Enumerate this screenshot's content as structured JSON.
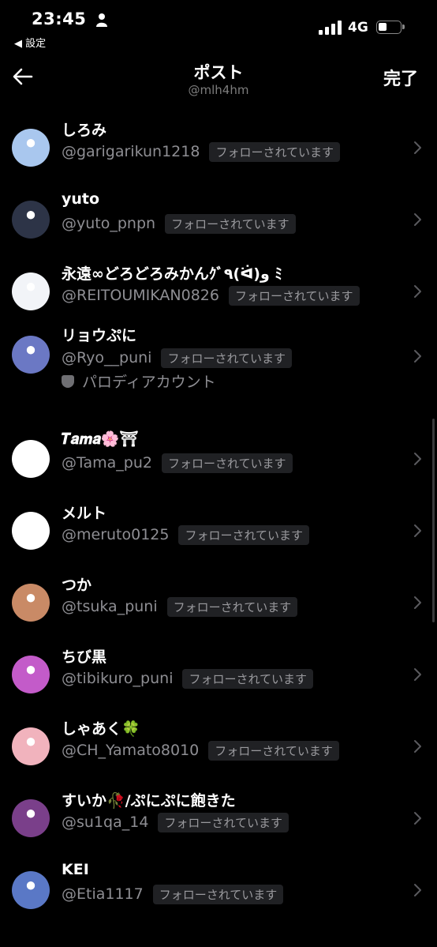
{
  "status_bar": {
    "time": "23:45",
    "back_app": "◀ 設定",
    "network": "4G"
  },
  "header": {
    "title": "ポスト",
    "subtitle": "@mlh4hm",
    "done_label": "完了"
  },
  "users": [
    {
      "name": "しろみ",
      "handle": "@garigarikun1218",
      "badge": "フォローされています",
      "avatar_color": "#a9c7ee"
    },
    {
      "name": "yuto",
      "handle": "@yuto_pnpn",
      "badge": "フォローされています",
      "avatar_color": "#2d3447"
    },
    {
      "name": "永遠∞どろどろみかんｸﾞ٩(ᐛ)و ﾐ",
      "handle": "@REITOUMIKAN0826",
      "badge": "フォローされています",
      "avatar_color": "#f2f4f8"
    },
    {
      "name": "リョウぷに",
      "handle": "@Ryo__puni",
      "badge": "フォローされています",
      "extra": "パロディアカウント",
      "avatar_color": "#6b78c4"
    },
    {
      "name": "𝑻𝒂𝒎𝒂🌸⛩",
      "handle": "@Tama_pu2",
      "badge": "フォローされています",
      "avatar_color": "#ffffff"
    },
    {
      "name": "メルト",
      "handle": "@meruto0125",
      "badge": "フォローされています",
      "avatar_color": "#ffffff"
    },
    {
      "name": "つか",
      "handle": "@tsuka_puni",
      "badge": "フォローされています",
      "avatar_color": "#c98a66"
    },
    {
      "name": "ちび黒",
      "handle": "@tibikuro_puni",
      "badge": "フォローされています",
      "avatar_color": "#c35bc9"
    },
    {
      "name": "しゃあく🍀",
      "handle": "@CH_Yamato8010",
      "badge": "フォローされています",
      "avatar_color": "#f1b3bd"
    },
    {
      "name": "すいか🥀/ぷにぷに飽きた",
      "handle": "@su1qa_14",
      "badge": "フォローされています",
      "avatar_color": "#7a3f8a"
    },
    {
      "name": "KEI",
      "handle": "@Etia1117",
      "badge": "フォローされています",
      "avatar_color": "#5a78c6"
    }
  ]
}
